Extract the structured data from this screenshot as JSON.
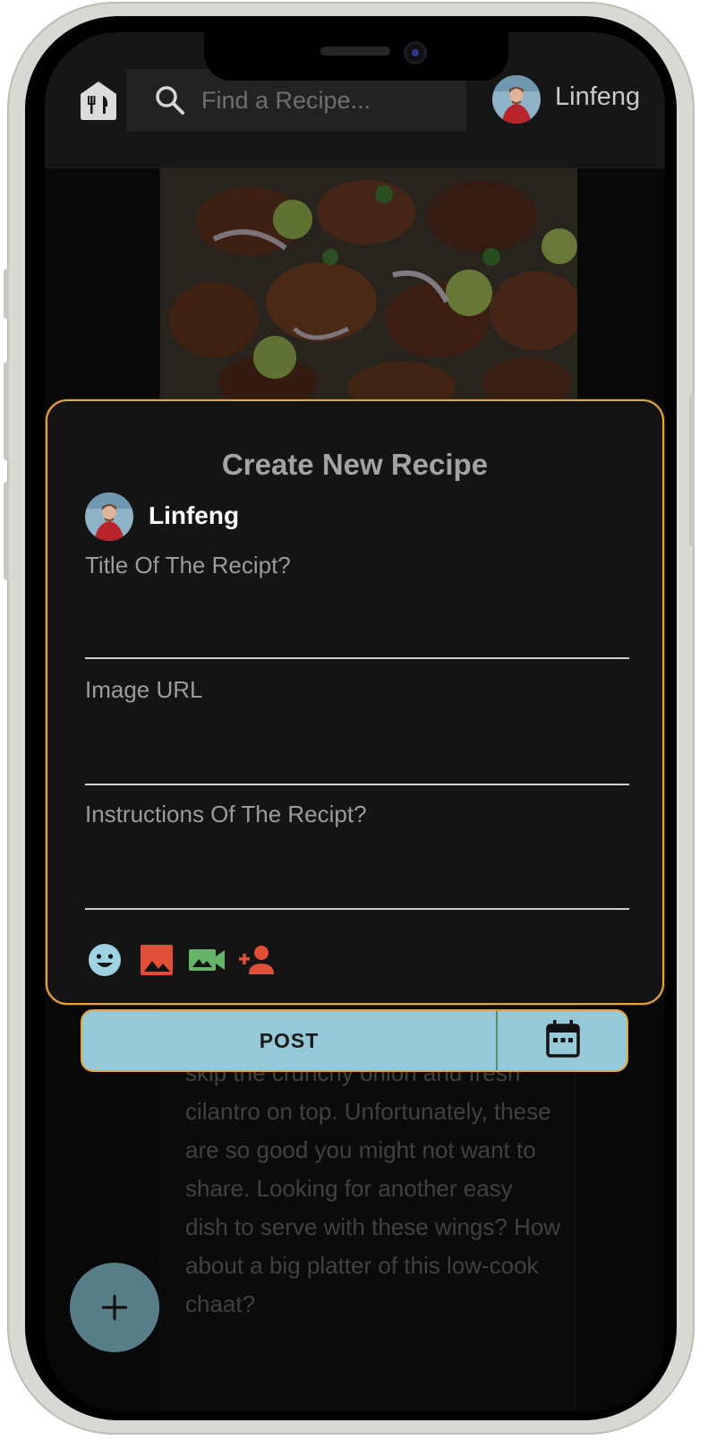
{
  "header": {
    "search_placeholder": "Find a Recipe...",
    "user_name": "Linfeng"
  },
  "post": {
    "text": "skip the crunchy onion and fresh cilantro on top. Unfortunately, these are so good you might not want to share. Looking for another easy dish to serve with these wings? How about a big platter of this low-cook chaat?"
  },
  "modal": {
    "title": "Create New Recipe",
    "user_name": "Linfeng",
    "fields": {
      "title_label": "Title Of The Recipt?",
      "image_label": "Image URL",
      "instructions_label": "Instructions Of The Recipt?",
      "title_value": "",
      "image_value": "",
      "instructions_value": ""
    },
    "tools": [
      "emoji-icon",
      "image-icon",
      "video-icon",
      "tag-person-icon"
    ]
  },
  "actions": {
    "post_label": "POST",
    "calendar_icon": "calendar-icon",
    "fab_icon": "plus-icon"
  },
  "colors": {
    "accent_border": "#e5a545",
    "post_button_bg": "#96c9d8",
    "fab_bg": "#587f88",
    "emoji": "#9fd3e3",
    "image": "#e04f36",
    "video": "#66b36a",
    "tag_person": "#e04f36"
  }
}
